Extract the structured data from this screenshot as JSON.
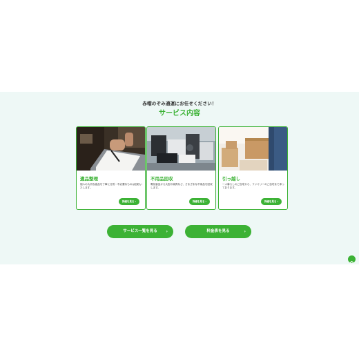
{
  "services": {
    "tagline": "赤帽のぞみ通運にお任せください！",
    "title": "サービス内容",
    "cards": [
      {
        "title": "遺品整理",
        "description": "個人の大切な遺品を丁寧に分別・不必要なものは回収いたします。",
        "button_label": "詳細を見る",
        "image_icon": "desk-paperwork-photo"
      },
      {
        "title": "不用品回収",
        "description": "電化製品から大型の家具など、さまざまな不用品を回収します。",
        "button_label": "詳細を見る",
        "image_icon": "junk-pile-photo"
      },
      {
        "title": "引っ越し",
        "description": "一人暮らしのご自宅から、ファミリーのご自宅まで承っております。",
        "button_label": "詳細を見る",
        "image_icon": "moving-boxes-photo"
      }
    ],
    "list_button_label": "サービス一覧を見る",
    "price_button_label": "料金表を見る",
    "arrow": "›"
  },
  "colors": {
    "accent": "#3cb235",
    "section_bg": "#eef8f6"
  }
}
